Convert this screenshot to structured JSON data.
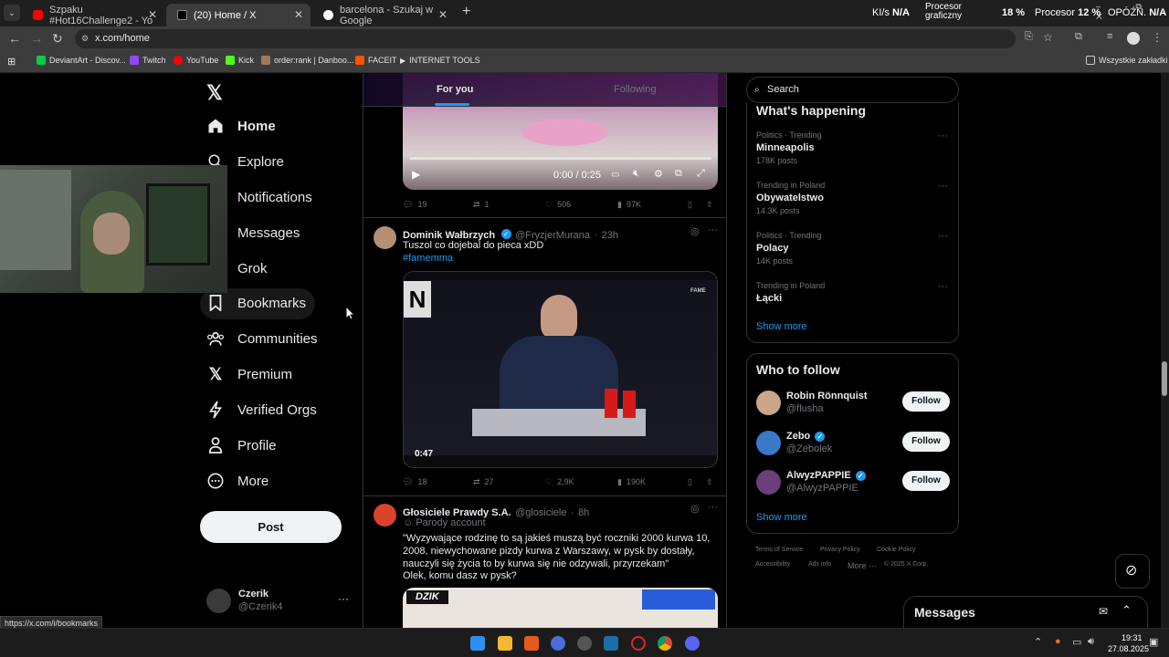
{
  "browser": {
    "tabs": [
      {
        "title": "Szpaku #Hot16Challenge2 - Yo",
        "active": false,
        "color": "#ff0000"
      },
      {
        "title": "(20) Home / X",
        "active": true,
        "color": "#ffffff"
      },
      {
        "title": "barcelona - Szukaj w Google",
        "active": false,
        "color": "#4285f4"
      }
    ],
    "new_tab": "+",
    "stats": {
      "kl_label": "KI/s",
      "kl_value": "N/A",
      "gpu_label": "Procesor",
      "gpu_label2": "graficzny",
      "gpu_value": "18 %",
      "cpu_label": "Procesor",
      "cpu_value": "12 %",
      "delay_label": "OPÓŹN.",
      "delay_value": "N/A"
    },
    "url": "x.com/home",
    "bookmarks": [
      "DeviantArt - Discov...",
      "Twitch",
      "YouTube",
      "Kick",
      "order:rank | Danboo...",
      "FACEIT",
      "INTERNET TOOLS"
    ],
    "bookmarks_all": "Wszystkie zakładki",
    "status_url": "https://x.com/i/bookmarks"
  },
  "nav": {
    "items": [
      {
        "label": "Home",
        "icon": "home-icon"
      },
      {
        "label": "Explore",
        "icon": "search-icon"
      },
      {
        "label": "Notifications",
        "icon": "bell-icon"
      },
      {
        "label": "Messages",
        "icon": "mail-icon"
      },
      {
        "label": "Grok",
        "icon": "grok-icon"
      },
      {
        "label": "Bookmarks",
        "icon": "bookmark-icon"
      },
      {
        "label": "Communities",
        "icon": "communities-icon"
      },
      {
        "label": "Premium",
        "icon": "x-logo-icon"
      },
      {
        "label": "Verified Orgs",
        "icon": "lightning-icon"
      },
      {
        "label": "Profile",
        "icon": "person-icon"
      },
      {
        "label": "More",
        "icon": "more-circle-icon"
      }
    ],
    "post_label": "Post",
    "user_name": "Czerik",
    "user_handle": "@Czerik4"
  },
  "timeline": {
    "tab_for_you": "For you",
    "tab_following": "Following",
    "video1": {
      "time": "0:00 / 0:25"
    },
    "tweet1_actions": {
      "replies": "19",
      "reposts": "1",
      "likes": "506",
      "views": "97K"
    },
    "tweet2": {
      "name": "Dominik Wałbrzych",
      "handle": "@FryzjerMurana",
      "time": "23h",
      "text": "Tuszol co dojebal do pieca xDD",
      "hashtag": "#famemma",
      "duration": "0:47",
      "replies": "18",
      "reposts": "27",
      "likes": "2,9K",
      "views": "190K"
    },
    "tweet3": {
      "name": "Głosiciele Prawdy S.A.",
      "handle": "@glosiciele",
      "time": "8h",
      "badge": "Parody account",
      "text": "\"Wyzywające rodzinę to są jakieś muszą być roczniki 2000 kurwa 10, 2008, niewychowane pizdy kurwa z Warszawy, w pysk by dostały, nauczyli się życia to by kurwa się nie odzywali, przyrzekam\"",
      "text2": "Olek, komu dasz w pysk?",
      "image_brand": "DZIK"
    }
  },
  "sidebar": {
    "search_placeholder": "Search",
    "happening_title": "What's happening",
    "trends": [
      {
        "category": "Politics · Trending",
        "name": "Minneapolis",
        "count": "178K posts"
      },
      {
        "category": "Trending in Poland",
        "name": "Obywatelstwo",
        "count": "14.3K posts"
      },
      {
        "category": "Politics · Trending",
        "name": "Polacy",
        "count": "14K posts"
      },
      {
        "category": "Trending in Poland",
        "name": "Łącki",
        "count": ""
      }
    ],
    "show_more": "Show more",
    "who_to_follow": "Who to follow",
    "follow": [
      {
        "name": "Robin Rönnquist",
        "handle": "@flusha",
        "verified": false
      },
      {
        "name": "Zebo",
        "handle": "@Zebolek",
        "verified": true
      },
      {
        "name": "AlwyzPAPPIE",
        "handle": "@AlwyzPAPPIE",
        "verified": true
      }
    ],
    "follow_label": "Follow",
    "show_more2": "Show more",
    "footer": [
      "Terms of Service",
      "Privacy Policy",
      "Cookie Policy",
      "Accessibility",
      "Ads info",
      "More ···",
      "© 2025 X Corp."
    ],
    "messages_title": "Messages"
  },
  "taskbar": {
    "time": "19:31",
    "date": "27.08.2025"
  }
}
